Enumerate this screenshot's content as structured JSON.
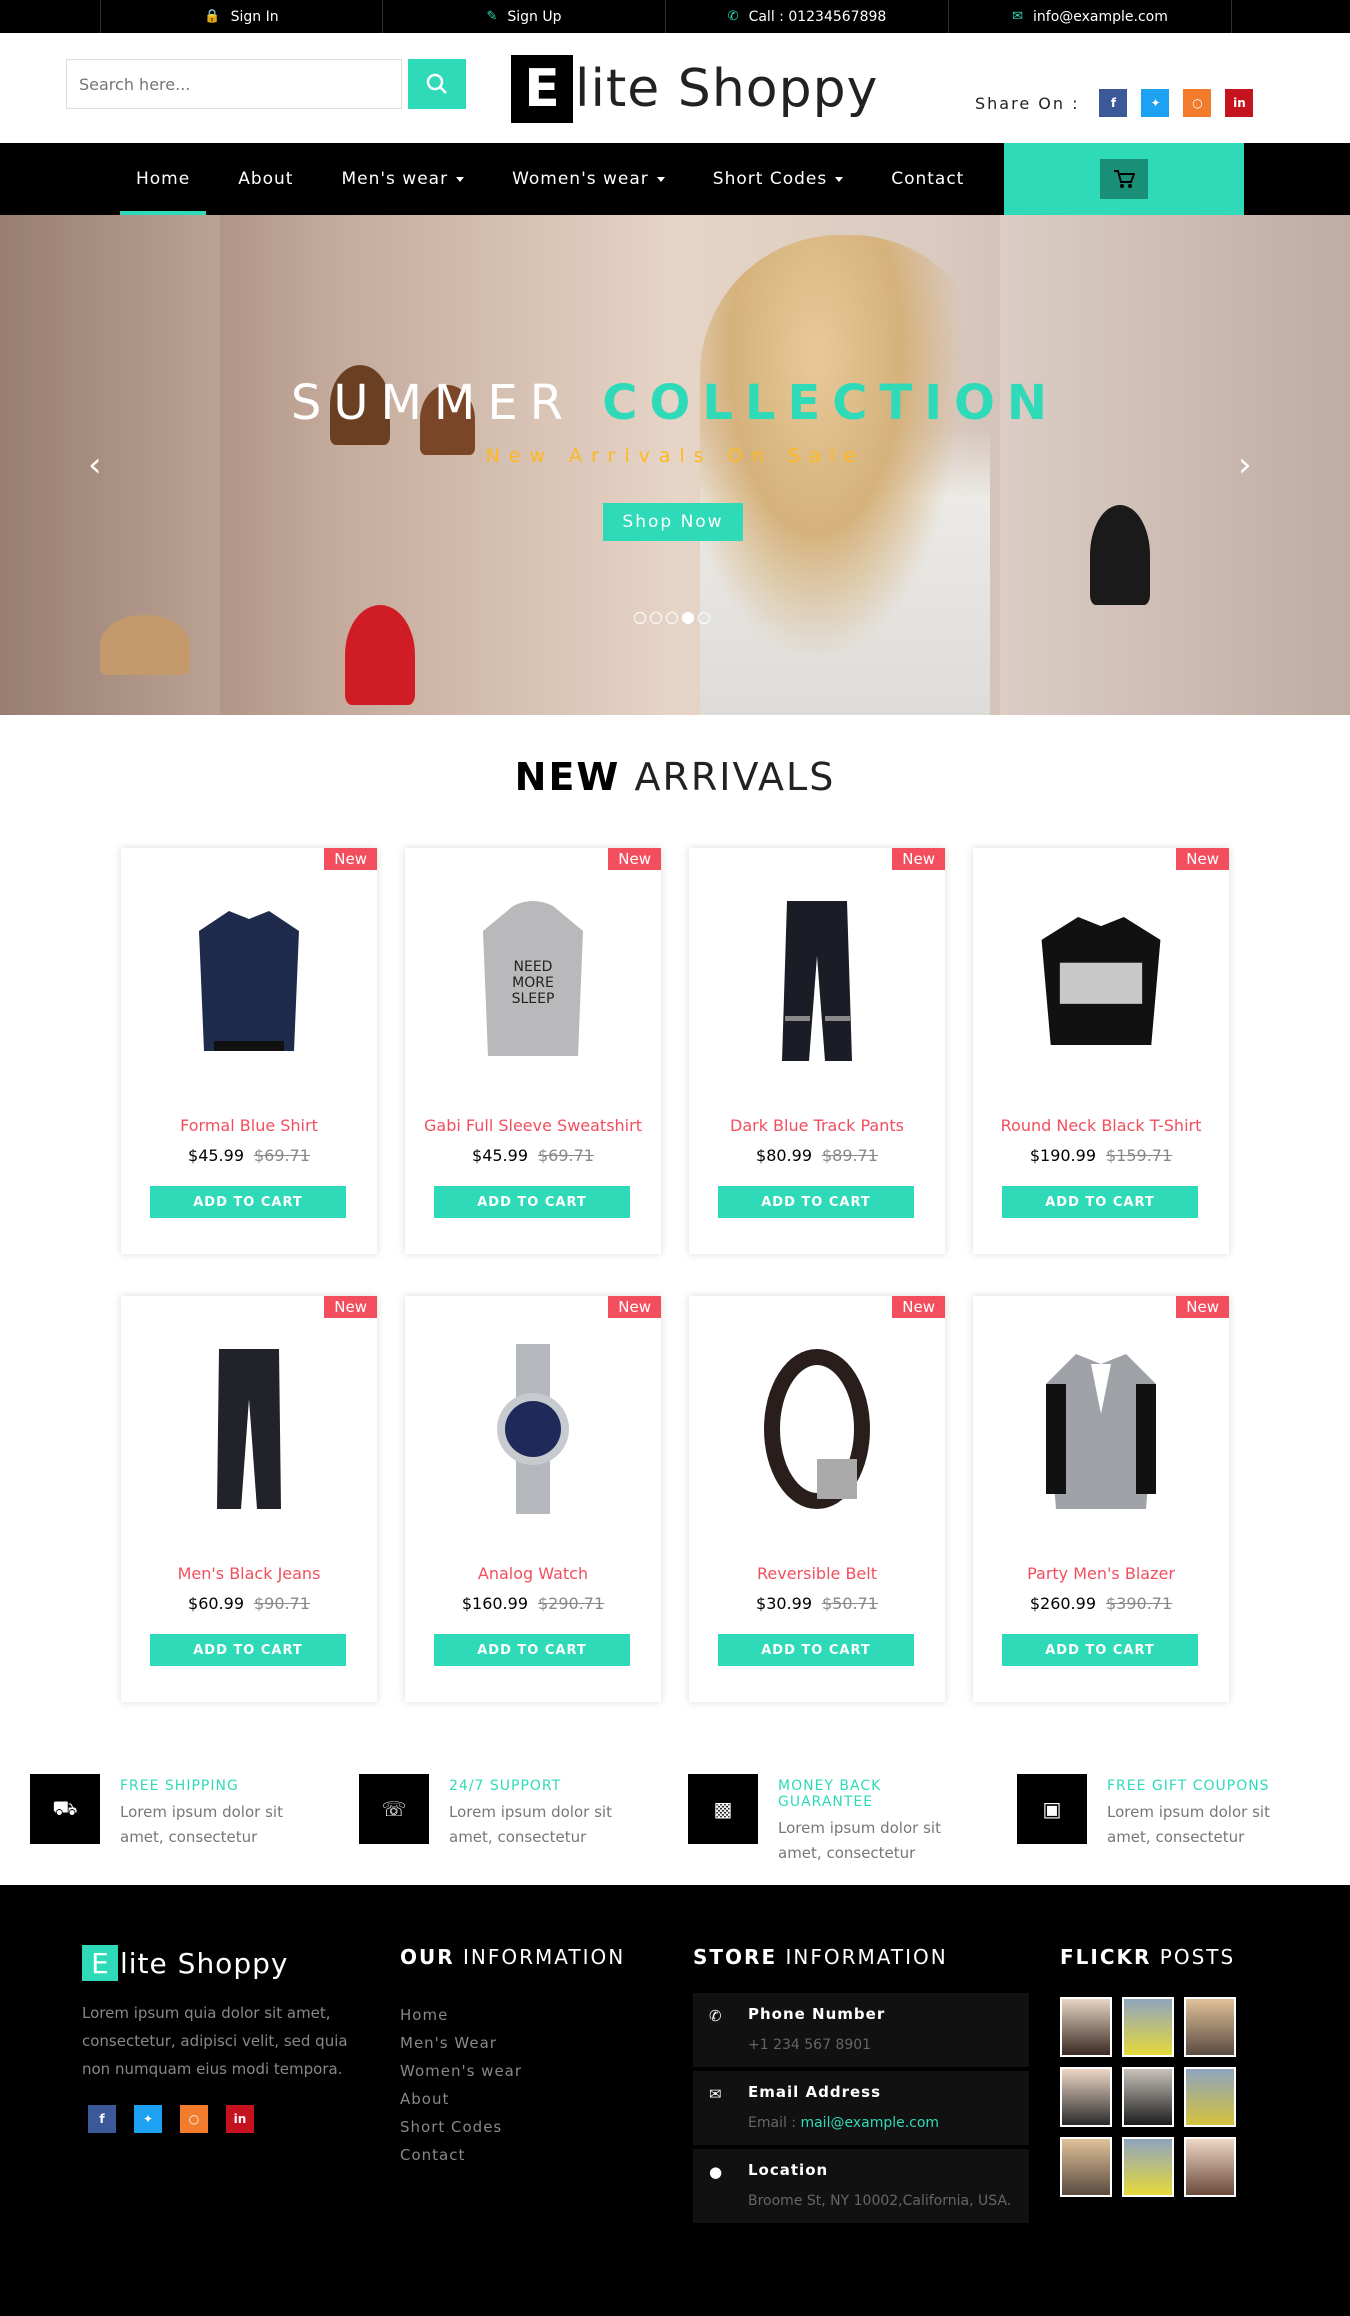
{
  "topbar": {
    "sign_in": "Sign In",
    "sign_up": "Sign Up",
    "call": "Call : 01234567898",
    "email": "info@example.com"
  },
  "header": {
    "search_placeholder": "Search here...",
    "logo_letter": "E",
    "logo_rest": "lite Shoppy",
    "share_label": "Share On :"
  },
  "nav": {
    "items": [
      "Home",
      "About",
      "Men's wear",
      "Women's wear",
      "Short Codes",
      "Contact"
    ],
    "active": "Home"
  },
  "hero": {
    "title_light": "SUMMER",
    "title_bold": "COLLECTION",
    "subtitle": "New Arrivals On Sale",
    "button": "Shop Now",
    "slides": 5,
    "active_slide": 4
  },
  "arrivals": {
    "title_bold": "NEW",
    "title_light": "ARRIVALS",
    "badge": "New",
    "cta": "ADD TO CART",
    "products": [
      {
        "name": "Formal Blue Shirt",
        "price": "$45.99",
        "old": "$69.71",
        "icon": "shirt-icon"
      },
      {
        "name": "Gabi Full Sleeve Sweatshirt",
        "price": "$45.99",
        "old": "$69.71",
        "icon": "hoodie-icon"
      },
      {
        "name": "Dark Blue Track Pants",
        "price": "$80.99",
        "old": "$89.71",
        "icon": "pants-icon"
      },
      {
        "name": "Round Neck Black T-Shirt",
        "price": "$190.99",
        "old": "$159.71",
        "icon": "tshirt-icon"
      },
      {
        "name": "Men's Black Jeans",
        "price": "$60.99",
        "old": "$90.71",
        "icon": "jeans-icon"
      },
      {
        "name": "Analog Watch",
        "price": "$160.99",
        "old": "$290.71",
        "icon": "watch-icon"
      },
      {
        "name": "Reversible Belt",
        "price": "$30.99",
        "old": "$50.71",
        "icon": "belt-icon"
      },
      {
        "name": "Party Men's Blazer",
        "price": "$260.99",
        "old": "$390.71",
        "icon": "blazer-icon"
      }
    ]
  },
  "features": [
    {
      "title": "FREE SHIPPING",
      "text": "Lorem ipsum dolor sit amet, consectetur",
      "icon": "truck-icon"
    },
    {
      "title": "24/7 SUPPORT",
      "text": "Lorem ipsum dolor sit amet, consectetur",
      "icon": "headphones-icon"
    },
    {
      "title": "MONEY BACK GUARANTEE",
      "text": "Lorem ipsum dolor sit amet, consectetur",
      "icon": "shopping-bag-icon"
    },
    {
      "title": "FREE GIFT COUPONS",
      "text": "Lorem ipsum dolor sit amet, consectetur",
      "icon": "gift-icon"
    }
  ],
  "footer": {
    "logo_letter": "E",
    "logo_rest": "lite Shoppy",
    "about": "Lorem ipsum quia dolor sit amet, consectetur, adipisci velit, sed quia non numquam eius modi tempora.",
    "info_bold": "OUR",
    "info_light": "INFORMATION",
    "links": [
      "Home",
      "Men's Wear",
      "Women's wear",
      "About",
      "Short Codes",
      "Contact"
    ],
    "store_bold": "STORE",
    "store_light": "INFORMATION",
    "phone_label": "Phone Number",
    "phone_value": "+1 234 567 8901",
    "email_label": "Email Address",
    "email_prefix": "Email :",
    "email_value": "mail@example.com",
    "location_label": "Location",
    "location_value": "Broome St, NY 10002,California, USA.",
    "flickr_bold": "FLICKR",
    "flickr_light": "POSTS"
  },
  "colors": {
    "accent": "#2fdab8",
    "sale_red": "#f24e5e",
    "subtitle_gold": "#ffb81c",
    "facebook": "#3b5998",
    "twitter": "#1da1f2",
    "instagram": "#f37b2c",
    "linkedin": "#c4121f"
  }
}
